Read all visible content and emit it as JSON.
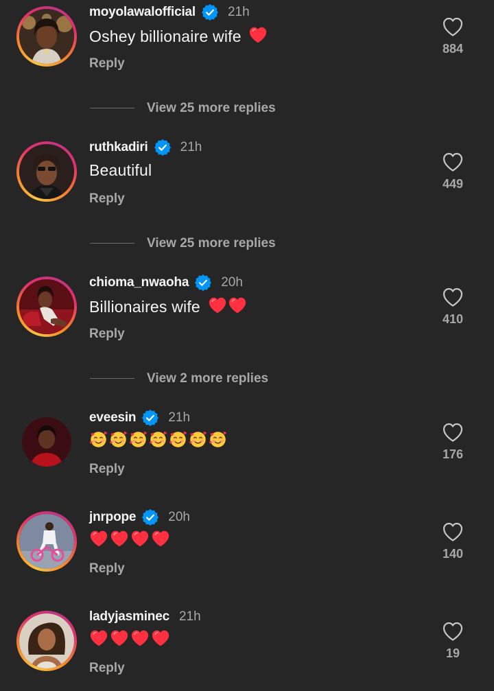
{
  "colors": {
    "background": "#262626",
    "text_primary": "#f5f5f5",
    "text_secondary": "#a8a8a8",
    "verified_blue": "#0095f6",
    "heart_red": "#ff3040"
  },
  "reply_label": "Reply",
  "comments": [
    {
      "username": "moyolawalofficial",
      "verified": true,
      "time": "21h",
      "text": "Oshey billionaire wife ❤️",
      "text_only": "Oshey billionaire wife",
      "trailing_emoji": [
        "red-heart"
      ],
      "likes": "884",
      "view_more": "View 25 more replies"
    },
    {
      "username": "ruthkadiri",
      "verified": true,
      "time": "21h",
      "text": "Beautiful",
      "text_only": "Beautiful",
      "trailing_emoji": [],
      "likes": "449",
      "view_more": "View 25 more replies"
    },
    {
      "username": "chioma_nwaoha",
      "verified": true,
      "time": "20h",
      "text": "Billionaires wife ❤️❤️",
      "text_only": "Billionaires wife",
      "trailing_emoji": [
        "red-heart",
        "red-heart"
      ],
      "likes": "410",
      "view_more": "View 2 more replies"
    },
    {
      "username": "eveesin",
      "verified": true,
      "time": "21h",
      "text": "🥰🥰🥰🥰🥰🥰🥰",
      "emoji": [
        "smiling-face-with-hearts",
        "smiling-face-with-hearts",
        "smiling-face-with-hearts",
        "smiling-face-with-hearts",
        "smiling-face-with-hearts",
        "smiling-face-with-hearts",
        "smiling-face-with-hearts"
      ],
      "likes": "176"
    },
    {
      "username": "jnrpope",
      "verified": true,
      "time": "20h",
      "text": "❤️❤️❤️❤️",
      "emoji": [
        "red-heart",
        "red-heart",
        "red-heart",
        "red-heart"
      ],
      "likes": "140"
    },
    {
      "username": "ladyjasminec",
      "verified": false,
      "time": "21h",
      "text": "❤️❤️❤️❤️",
      "emoji": [
        "red-heart",
        "red-heart",
        "red-heart",
        "red-heart"
      ],
      "likes": "19"
    }
  ]
}
